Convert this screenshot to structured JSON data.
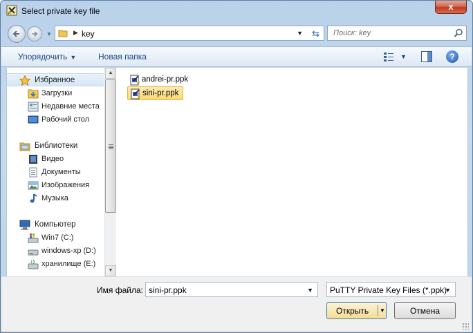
{
  "window": {
    "title": "Select private key file",
    "close_label": "x"
  },
  "address": {
    "path": "key",
    "search_placeholder": "Поиск: key"
  },
  "toolbar": {
    "organize_label": "Упорядочить",
    "new_folder_label": "Новая папка"
  },
  "navigation": {
    "favorites": {
      "label": "Избранное",
      "items": [
        {
          "label": "Загрузки",
          "icon": "downloads-folder-icon"
        },
        {
          "label": "Недавние места",
          "icon": "recent-places-icon"
        },
        {
          "label": "Рабочий стол",
          "icon": "desktop-icon"
        }
      ]
    },
    "libraries": {
      "label": "Библиотеки",
      "items": [
        {
          "label": "Видео",
          "icon": "video-icon"
        },
        {
          "label": "Документы",
          "icon": "documents-icon"
        },
        {
          "label": "Изображения",
          "icon": "pictures-icon"
        },
        {
          "label": "Музыка",
          "icon": "music-icon"
        }
      ]
    },
    "computer": {
      "label": "Компьютер",
      "items": [
        {
          "label": "Win7 (C:)",
          "icon": "windows-drive-icon"
        },
        {
          "label": "windows-xp (D:)",
          "icon": "drive-icon"
        },
        {
          "label": "хранилище (E:)",
          "icon": "removable-drive-icon"
        }
      ]
    }
  },
  "files": [
    {
      "name": "andrei-pr.ppk",
      "icon": "putty-key-icon",
      "selected": false
    },
    {
      "name": "sini-pr.ppk",
      "icon": "putty-key-icon",
      "selected": true
    }
  ],
  "bottom": {
    "filename_label": "Имя файла:",
    "filename_value": "sini-pr.ppk",
    "filter_value": "PuTTY Private Key Files (*.ppk)",
    "open_label": "Открыть",
    "cancel_label": "Отмена"
  },
  "colors": {
    "accent": "#1b4a83",
    "selection": "#fbd97a"
  }
}
